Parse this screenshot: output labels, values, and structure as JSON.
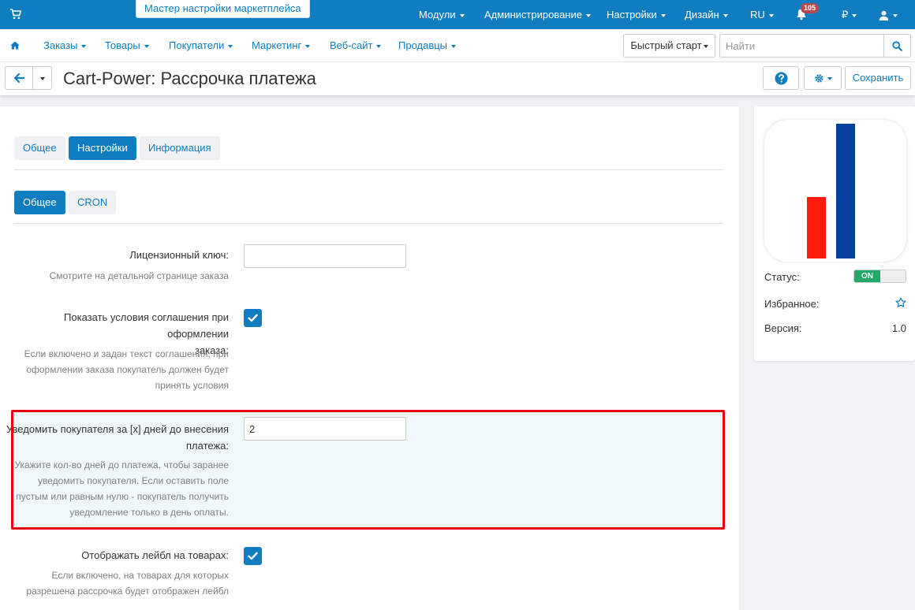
{
  "topbar": {
    "wizard_label": "Мастер настройки маркетплейса",
    "menu": [
      {
        "label": "Модули"
      },
      {
        "label": "Администрирование"
      },
      {
        "label": "Настройки"
      },
      {
        "label": "Дизайн"
      },
      {
        "label": "RU"
      }
    ],
    "notifications_count": "105",
    "currency_symbol": "₽"
  },
  "nav": {
    "items": [
      {
        "label": "Заказы"
      },
      {
        "label": "Товары"
      },
      {
        "label": "Покупатели"
      },
      {
        "label": "Маркетинг"
      },
      {
        "label": "Веб-сайт"
      },
      {
        "label": "Продавцы"
      }
    ],
    "quick_start_label": "Быстрый старт",
    "search_placeholder": "Найти"
  },
  "titlebar": {
    "title": "Cart-Power: Рассрочка платежа",
    "save_label": "Сохранить"
  },
  "tabs": [
    {
      "label": "Общее",
      "active": false
    },
    {
      "label": "Настройки",
      "active": true
    },
    {
      "label": "Информация",
      "active": false
    }
  ],
  "subtabs": [
    {
      "label": "Общее",
      "active": true
    },
    {
      "label": "CRON",
      "active": false
    }
  ],
  "fields": {
    "license": {
      "label": "Лицензионный ключ:",
      "help": "Смотрите на детальной странице заказа",
      "value": ""
    },
    "agreement": {
      "label_lines": [
        "Показать условия соглашения при оформлении",
        "заказа:"
      ],
      "help_lines": [
        "Если включено и задан текст соглашения, при",
        "оформлении заказа покупатель должен будет",
        "принять условия"
      ],
      "checked": true
    },
    "notify": {
      "label_lines": [
        "Уведомить покупателя за [x] дней до внесения",
        "платежа:"
      ],
      "help_lines": [
        "Укажите кол-во дней до платежа, чтобы заранее",
        "уведомить покупателя. Если оставить поле",
        "пустым или равным нулю - покупатель получить",
        "уведомление только в день оплаты."
      ],
      "value": "2"
    },
    "label_on_products": {
      "label": "Отображать лейбл на товарах:",
      "help_lines": [
        "Если включено, на товарах для которых",
        "разрешена рассрочка будет отображен лейбл"
      ],
      "checked": true
    }
  },
  "sidebar": {
    "status_label": "Статус:",
    "status_value": "ON",
    "favorite_label": "Избранное:",
    "version_label": "Версия:",
    "version_value": "1.0"
  },
  "colors": {
    "brand": "#0f7dbf",
    "highlight_border": "#e8000d",
    "status_on": "#23a86a",
    "logo_red": "#ff1a0d",
    "logo_blue": "#033f9d"
  }
}
